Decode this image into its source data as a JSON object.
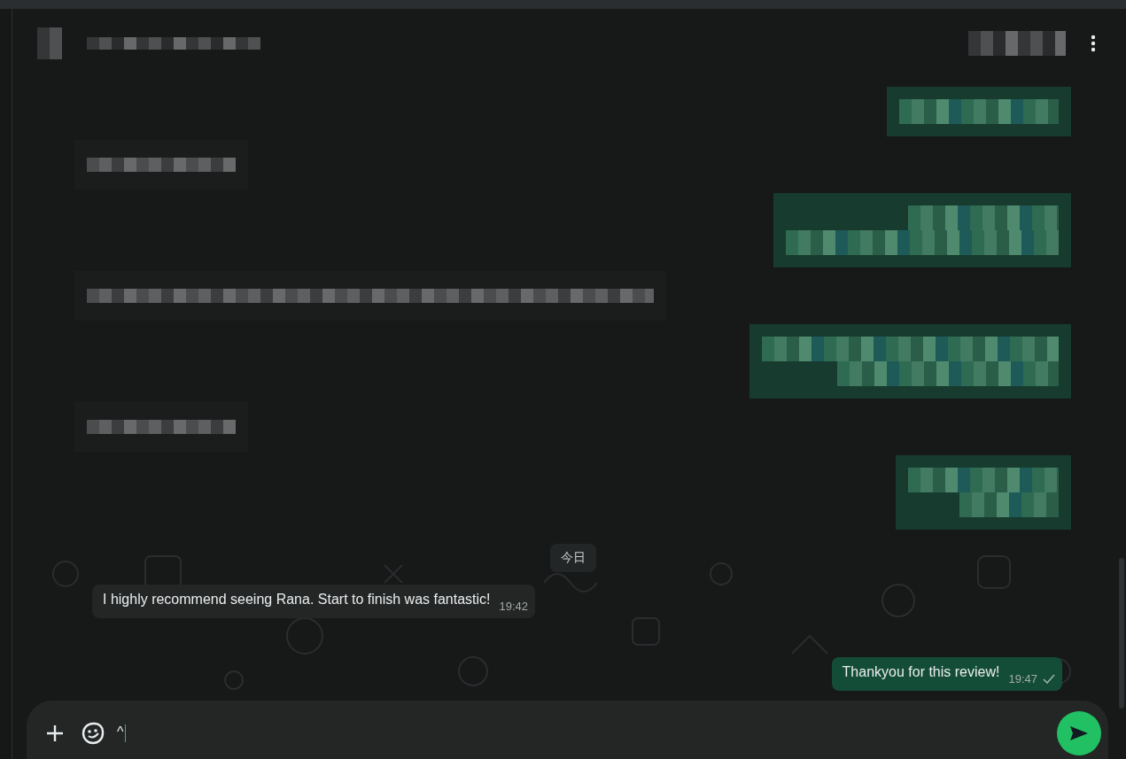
{
  "header": {
    "kind": "redacted"
  },
  "messages": [
    {
      "kind": "redacted",
      "outgoing": true
    },
    {
      "kind": "redacted",
      "outgoing": false
    },
    {
      "kind": "redacted",
      "outgoing": true
    },
    {
      "kind": "redacted",
      "outgoing": false
    },
    {
      "kind": "redacted",
      "outgoing": true
    },
    {
      "kind": "redacted",
      "outgoing": false
    },
    {
      "kind": "redacted",
      "outgoing": true
    },
    {
      "kind": "date",
      "text": "今日"
    },
    {
      "kind": "text",
      "outgoing": false,
      "text": "I highly recommend seeing Rana. Start to finish was fantastic!",
      "time": "19:42"
    },
    {
      "kind": "text",
      "outgoing": true,
      "text": "Thankyou for this review!",
      "time": "19:47",
      "ticked": true
    }
  ],
  "composer": {
    "value": "^"
  }
}
